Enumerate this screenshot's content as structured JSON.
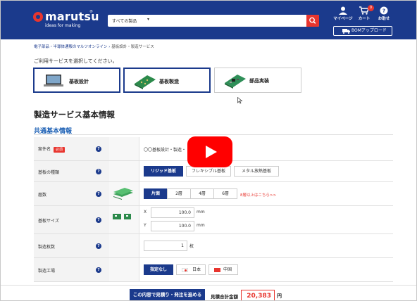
{
  "header": {
    "logo_text": "marutsu",
    "logo_reg": "®",
    "tagline": "ideas for making",
    "search_category": "すべての製品",
    "search_placeholder": "",
    "mypage_label": "マイページ",
    "cart_label": "カート",
    "cart_count": "0",
    "notice_label": "お助せ",
    "bom_label": "BOMアップロード"
  },
  "breadcrumb": {
    "items": [
      "電子部品・半導体通販のマルツオンライン",
      "基板設計・製造サービス"
    ],
    "separator": " › "
  },
  "service_prompt": "ご利用サービスを選択してください。",
  "services": [
    {
      "label": "基板設計",
      "selected": true,
      "icon": "laptop-icon"
    },
    {
      "label": "基板製造",
      "selected": true,
      "icon": "pcb-icon"
    },
    {
      "label": "部品実装",
      "selected": false,
      "icon": "pcb-assembly-icon"
    }
  ],
  "section_title": "製造サービス基本情報",
  "subsection_title": "共通基本情報",
  "form": {
    "project_name": {
      "label": "案件名",
      "required_label": "必須",
      "value": "〇〇基板設計・製造・"
    },
    "board_type": {
      "label": "基板の種類",
      "options": [
        "リジッド基板",
        "フレキシブル基板",
        "メタル放熱基板"
      ],
      "selected": "リジッド基板"
    },
    "layers": {
      "label": "層数",
      "options": [
        "片面",
        "2層",
        "4層",
        "6層"
      ],
      "selected": "片面",
      "link": "8層以上はこちら>>"
    },
    "board_size": {
      "label": "基板サイズ",
      "x_label": "X",
      "x_value": "100.0",
      "y_label": "Y",
      "y_value": "100.0",
      "unit": "mm"
    },
    "quantity": {
      "label": "製造枚数",
      "value": "1",
      "unit": "枚"
    },
    "factory": {
      "label": "製造工場",
      "options": [
        "指定なし",
        "日本",
        "中国"
      ],
      "selected": "指定なし"
    }
  },
  "help_glyph": "?",
  "footer": {
    "quote_button": "この内容で見積り・発注を進める",
    "total_label": "見積合計金額",
    "total_value": "20,383",
    "total_unit": "円"
  },
  "colors": {
    "brand_navy": "#1b3a8c",
    "accent_red": "#e8352e",
    "link_blue": "#1b5fb4"
  }
}
